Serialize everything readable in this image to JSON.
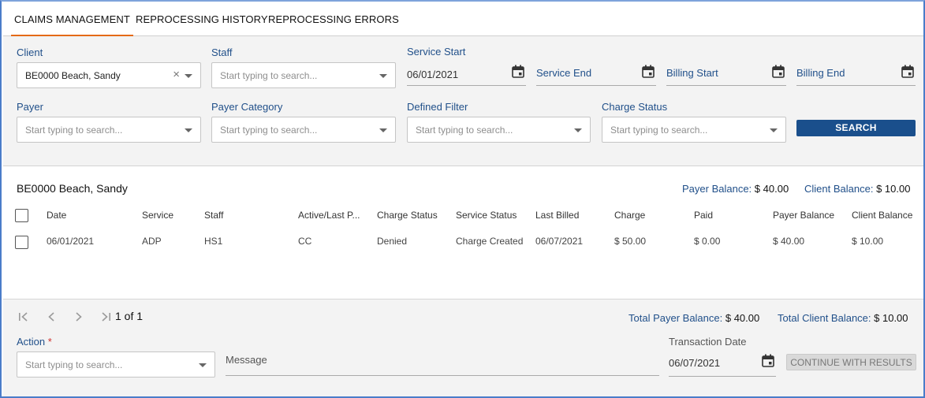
{
  "tabs": [
    {
      "label": "CLAIMS MANAGEMENT",
      "active": true
    },
    {
      "label": "REPROCESSING HISTORY",
      "active": false
    },
    {
      "label": "REPROCESSING ERRORS",
      "active": false
    }
  ],
  "filters": {
    "client": {
      "label": "Client",
      "value": "BE0000 Beach, Sandy"
    },
    "staff": {
      "label": "Staff",
      "placeholder": "Start typing to search..."
    },
    "service_start": {
      "label": "Service Start",
      "value": "06/01/2021"
    },
    "service_end": {
      "label": "Service End"
    },
    "billing_start": {
      "label": "Billing Start"
    },
    "billing_end": {
      "label": "Billing End"
    },
    "payer": {
      "label": "Payer",
      "placeholder": "Start typing to search..."
    },
    "payer_category": {
      "label": "Payer Category",
      "placeholder": "Start typing to search..."
    },
    "defined_filter": {
      "label": "Defined Filter",
      "placeholder": "Start typing to search..."
    },
    "charge_status": {
      "label": "Charge Status",
      "placeholder": "Start typing to search..."
    },
    "search_label": "SEARCH"
  },
  "results": {
    "client_name": "BE0000 Beach, Sandy",
    "payer_balance_label": "Payer Balance:",
    "payer_balance_value": "$ 40.00",
    "client_balance_label": "Client Balance:",
    "client_balance_value": "$ 10.00",
    "columns": [
      "Date",
      "Service",
      "Staff",
      "Active/Last P...",
      "Charge Status",
      "Service Status",
      "Last Billed",
      "Charge",
      "Paid",
      "Payer Balance",
      "Client Balance"
    ],
    "rows": [
      [
        "06/01/2021",
        "ADP",
        "HS1",
        "CC",
        "Denied",
        "Charge Created",
        "06/07/2021",
        "$ 50.00",
        "$ 0.00",
        "$ 40.00",
        "$ 10.00"
      ]
    ]
  },
  "footer": {
    "page_text": "1 of 1",
    "total_payer_label": "Total Payer Balance:",
    "total_payer_value": "$ 40.00",
    "total_client_label": "Total Client Balance:",
    "total_client_value": "$ 10.00",
    "action_label": "Action",
    "action_required_mark": "*",
    "action_placeholder": "Start typing to search...",
    "message_label": "Message",
    "transaction_date_label": "Transaction Date",
    "transaction_date_value": "06/07/2021",
    "continue_label": "CONTINUE WITH RESULTS"
  },
  "colors": {
    "accent_tab": "#e46a17",
    "primary_button": "#1a4f8c",
    "label_blue": "#21508a"
  }
}
